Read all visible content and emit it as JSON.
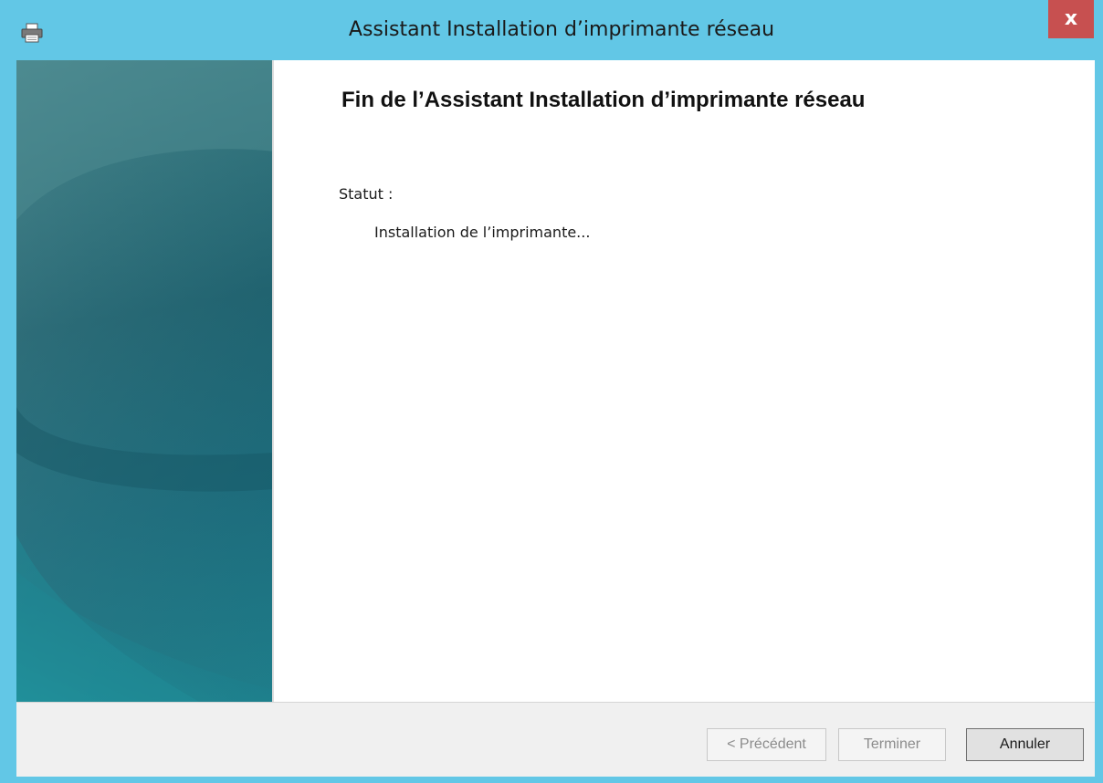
{
  "window": {
    "title": "Assistant Installation d’imprimante réseau",
    "close_label": "x",
    "icon": "printer-icon"
  },
  "wizard": {
    "heading": "Fin de l’Assistant Installation d’imprimante réseau",
    "status_label": "Statut :",
    "status_value": "Installation de l’imprimante..."
  },
  "buttons": {
    "previous": "< Précédent",
    "finish": "Terminer",
    "cancel": "Annuler"
  },
  "colors": {
    "titlebar": "#62c7e6",
    "close": "#c75050",
    "banner": "#1b5e6c"
  }
}
